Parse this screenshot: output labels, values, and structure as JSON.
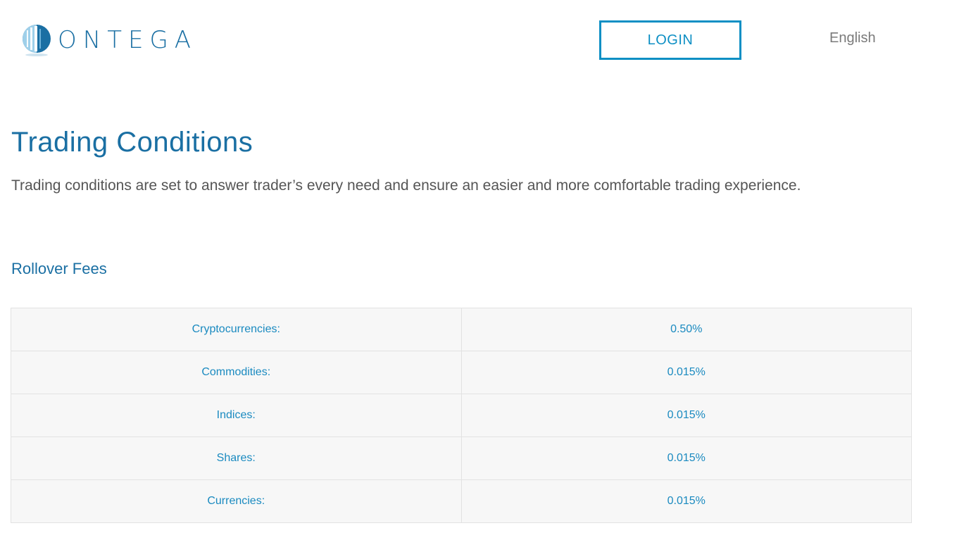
{
  "header": {
    "logo_text": "ONTEGA",
    "login_label": "LOGIN",
    "language_label": "English"
  },
  "main": {
    "title": "Trading Conditions",
    "subtitle": "Trading conditions are set to answer trader’s every need and ensure an easier and more comfortable trading experience.",
    "section_title": "Rollover Fees"
  },
  "rollover_fees": [
    {
      "label": "Cryptocurrencies:",
      "value": "0.50%"
    },
    {
      "label": "Commodities:",
      "value": "0.015%"
    },
    {
      "label": "Indices:",
      "value": "0.015%"
    },
    {
      "label": "Shares:",
      "value": "0.015%"
    },
    {
      "label": "Currencies:",
      "value": "0.015%"
    }
  ],
  "colors": {
    "brand_blue": "#1a6fa3",
    "accent_blue": "#0d8fc4",
    "table_bg": "#f7f7f7"
  }
}
